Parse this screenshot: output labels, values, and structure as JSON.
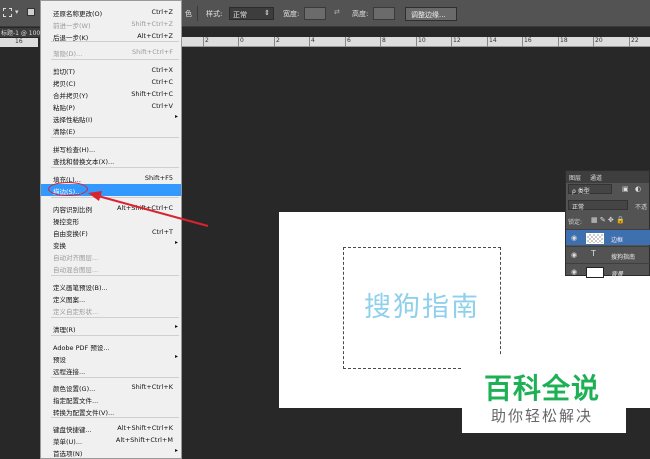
{
  "options_bar": {
    "partial_label": "色",
    "style_label": "样式:",
    "style_value": "正常",
    "width_label": "宽度:",
    "height_label": "高度:",
    "refine_button": "调整边缘..."
  },
  "document": {
    "tab_label": "标题-1 @ 100",
    "ruler_ticks": [
      "16",
      "4",
      "2",
      "0",
      "2",
      "4",
      "6",
      "8",
      "10",
      "12",
      "14",
      "16",
      "18",
      "20",
      "22"
    ],
    "vruler_label": "16"
  },
  "menu": {
    "items": [
      {
        "label": "还原名称更改(O)",
        "shortcut": "Ctrl+Z",
        "disabled": false
      },
      {
        "label": "前进一步(W)",
        "shortcut": "Shift+Ctrl+Z",
        "disabled": true
      },
      {
        "label": "后退一步(K)",
        "shortcut": "Alt+Ctrl+Z",
        "disabled": false
      },
      {
        "label": "渐隐(D)...",
        "shortcut": "Shift+Ctrl+F",
        "disabled": true
      },
      {
        "label": "剪切(T)",
        "shortcut": "Ctrl+X",
        "disabled": false
      },
      {
        "label": "拷贝(C)",
        "shortcut": "Ctrl+C",
        "disabled": false
      },
      {
        "label": "合并拷贝(Y)",
        "shortcut": "Shift+Ctrl+C",
        "disabled": false
      },
      {
        "label": "粘贴(P)",
        "shortcut": "Ctrl+V",
        "disabled": false
      },
      {
        "label": "选择性粘贴(I)",
        "shortcut": "",
        "disabled": false,
        "submenu": true
      },
      {
        "label": "清除(E)",
        "shortcut": "",
        "disabled": false
      },
      {
        "label": "拼写检查(H)...",
        "shortcut": "",
        "disabled": false
      },
      {
        "label": "查找和替换文本(X)...",
        "shortcut": "",
        "disabled": false
      },
      {
        "label": "填充(L)...",
        "shortcut": "Shift+F5",
        "disabled": false
      },
      {
        "label": "描边(S)...",
        "shortcut": "",
        "disabled": false,
        "highlighted": true
      },
      {
        "label": "内容识别比例",
        "shortcut": "Alt+Shift+Ctrl+C",
        "disabled": false
      },
      {
        "label": "操控变形",
        "shortcut": "",
        "disabled": false
      },
      {
        "label": "自由变换(F)",
        "shortcut": "Ctrl+T",
        "disabled": false
      },
      {
        "label": "变换",
        "shortcut": "",
        "disabled": false,
        "submenu": true
      },
      {
        "label": "自动对齐图层...",
        "shortcut": "",
        "disabled": true
      },
      {
        "label": "自动混合图层...",
        "shortcut": "",
        "disabled": true
      },
      {
        "label": "定义画笔预设(B)...",
        "shortcut": "",
        "disabled": false
      },
      {
        "label": "定义图案...",
        "shortcut": "",
        "disabled": false
      },
      {
        "label": "定义自定形状...",
        "shortcut": "",
        "disabled": true
      },
      {
        "label": "清理(R)",
        "shortcut": "",
        "disabled": false,
        "submenu": true
      },
      {
        "label": "Adobe PDF 预设...",
        "shortcut": "",
        "disabled": false
      },
      {
        "label": "预设",
        "shortcut": "",
        "disabled": false,
        "submenu": true
      },
      {
        "label": "远程连接...",
        "shortcut": "",
        "disabled": false
      },
      {
        "label": "颜色设置(G)...",
        "shortcut": "Shift+Ctrl+K",
        "disabled": false
      },
      {
        "label": "指定配置文件...",
        "shortcut": "",
        "disabled": false
      },
      {
        "label": "转换为配置文件(V)...",
        "shortcut": "",
        "disabled": false
      },
      {
        "label": "键盘快捷键...",
        "shortcut": "Alt+Shift+Ctrl+K",
        "disabled": false
      },
      {
        "label": "菜单(U)...",
        "shortcut": "Alt+Shift+Ctrl+M",
        "disabled": false
      },
      {
        "label": "首选项(N)",
        "shortcut": "",
        "disabled": false,
        "submenu": true
      }
    ]
  },
  "canvas": {
    "text": "搜狗指南",
    "text_color": "#8fd0ec"
  },
  "layers_panel": {
    "tab_layers": "图层",
    "tab_channels": "通道",
    "filter_label": "ρ 类型",
    "blend_mode": "正常",
    "opacity_label": "不透",
    "lock_label": "锁定:",
    "layers": [
      {
        "name": "边框",
        "type": "pixel",
        "selected": true
      },
      {
        "name": "搜狗指南",
        "type": "text",
        "selected": false
      },
      {
        "name": "背景",
        "type": "background",
        "selected": false
      }
    ]
  },
  "watermark": {
    "line1": "百科全说",
    "line2": "助你轻松解决",
    "color": "#1db055"
  },
  "colors": {
    "highlight": "#3399ff",
    "annotation": "#d9232e",
    "layer_selected": "#3e6fae"
  }
}
